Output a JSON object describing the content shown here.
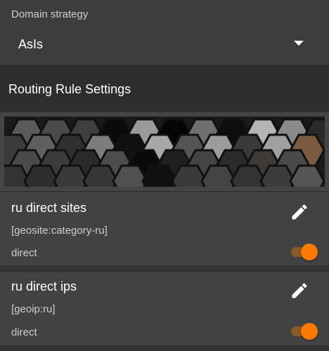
{
  "domain_strategy": {
    "label": "Domain strategy",
    "value": "AsIs"
  },
  "routing_section": {
    "title": "Routing Rule Settings"
  },
  "rules": [
    {
      "name": "ru direct sites",
      "domain": "[geosite:category-ru]",
      "outbound": "direct",
      "enabled": true
    },
    {
      "name": "ru direct ips",
      "domain": "[geoip:ru]",
      "outbound": "direct",
      "enabled": true
    }
  ],
  "colors": {
    "accent": "#ff7a00",
    "toggle_track": "#8a5a2a"
  },
  "icons": {
    "dropdown": "chevron-down-icon",
    "edit": "pencil-icon"
  }
}
